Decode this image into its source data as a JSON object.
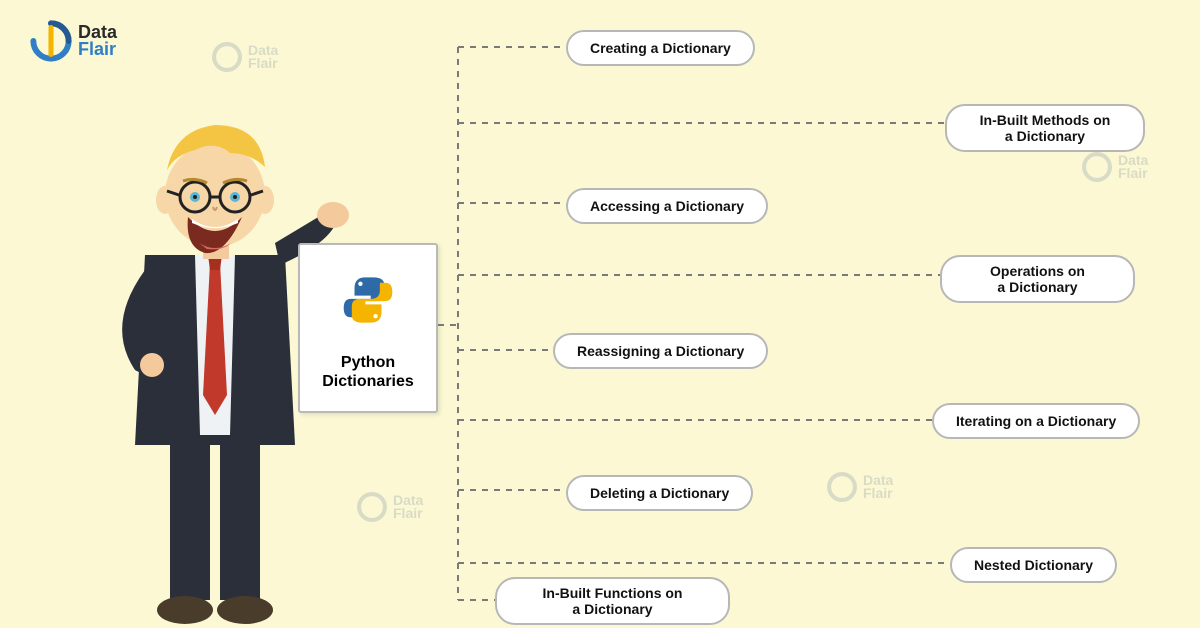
{
  "brand": {
    "name_line1": "Data",
    "name_line2": "Flair"
  },
  "central": {
    "title_line1": "Python",
    "title_line2": "Dictionaries"
  },
  "topics": [
    "Creating a Dictionary",
    "In-Built Methods on\na Dictionary",
    "Accessing a Dictionary",
    "Operations on\na Dictionary",
    "Reassigning a Dictionary",
    "Iterating on a Dictionary",
    "Deleting a Dictionary",
    "Nested Dictionary",
    "In-Built Functions on\na Dictionary"
  ]
}
